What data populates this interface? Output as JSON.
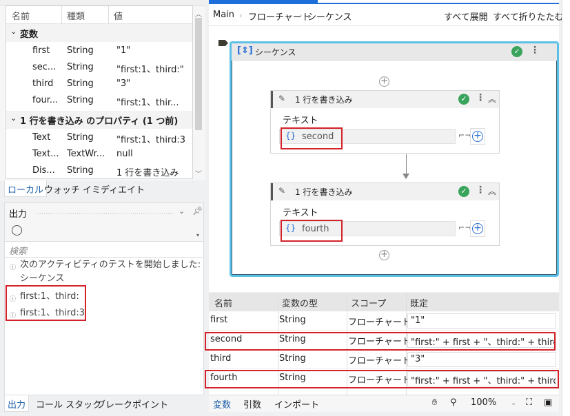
{
  "locals": {
    "title": "ローカル",
    "columns": [
      "名前",
      "種類",
      "値"
    ],
    "groups": [
      {
        "label": "変数",
        "rows": [
          {
            "name": "first",
            "type": "String",
            "value": "\"1\""
          },
          {
            "name": "sec...",
            "type": "String",
            "value": "\"first:1、third:\""
          },
          {
            "name": "third",
            "type": "String",
            "value": "\"3\""
          },
          {
            "name": "four...",
            "type": "String",
            "value": "\"first:1、thir..."
          }
        ]
      },
      {
        "label": "1 行を書き込み のプロパティ (1 つ前)",
        "rows": [
          {
            "name": "Text",
            "type": "String",
            "value": "\"first:1、third:3"
          },
          {
            "name": "Text...",
            "type": "TextWr...",
            "value": "null"
          },
          {
            "name": "Dis...",
            "type": "String",
            "value": "1 行を書き込み"
          }
        ]
      }
    ],
    "tabs": [
      "ローカル",
      "ウォッチ",
      "イミディエイト"
    ]
  },
  "output": {
    "title": "出力",
    "search_placeholder": "検索",
    "lines": [
      "次のアクティビティのテストを開始しました: シーケンス",
      "first:1、third:",
      "first:1、third:3"
    ],
    "tabs": [
      "出力",
      "コール スタック",
      "ブレークポイント"
    ]
  },
  "designer": {
    "breadcrumb": [
      "Main",
      "フローチャート",
      "シーケンス"
    ],
    "expand_all": "すべて展開",
    "collapse_all": "すべて折りたたむ",
    "sequence": {
      "title": "シーケンス",
      "activities": [
        {
          "title": "1 行を書き込み",
          "field_label": "テキスト",
          "field_value": "second"
        },
        {
          "title": "1 行を書き込み",
          "field_label": "テキスト",
          "field_value": "fourth"
        }
      ]
    }
  },
  "variables": {
    "columns": [
      "名前",
      "変数の型",
      "スコープ",
      "既定"
    ],
    "rows": [
      {
        "name": "first",
        "type": "String",
        "scope": "フローチャート",
        "default": "\"1\""
      },
      {
        "name": "second",
        "type": "String",
        "scope": "フローチャート",
        "default": "\"first:\" + first + \"、third:\" + third"
      },
      {
        "name": "third",
        "type": "String",
        "scope": "フローチャート",
        "default": "\"3\""
      },
      {
        "name": "fourth",
        "type": "String",
        "scope": "フローチャート",
        "default": "\"first:\" + first + \"、third:\" + third"
      }
    ],
    "tabs": [
      "変数",
      "引数",
      "インポート"
    ],
    "zoom": "100%"
  },
  "colors": {
    "accent": "#1e6fd9",
    "highlight": "#d3222a",
    "selection_border": "#5bc0e6",
    "ok": "#3aa35c"
  }
}
